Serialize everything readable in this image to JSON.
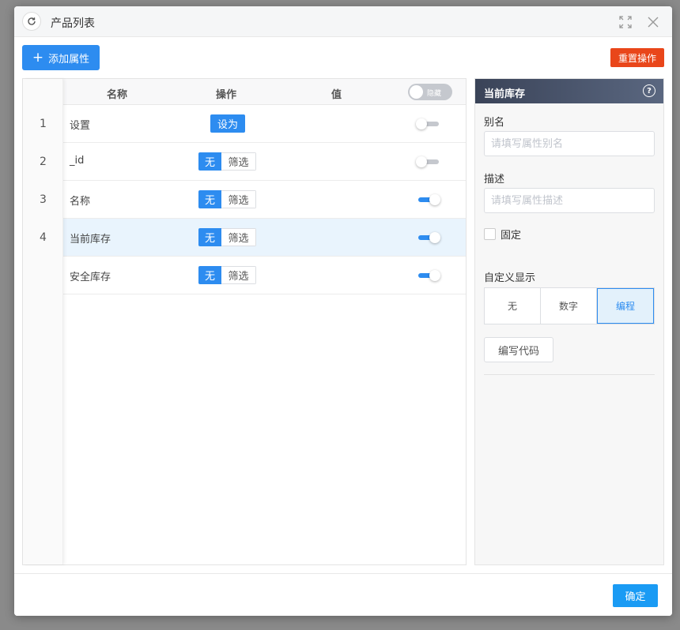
{
  "dialog": {
    "title": "产品列表"
  },
  "toolbar": {
    "add_label": "添加属性",
    "reset_label": "重置操作"
  },
  "table": {
    "headers": {
      "name": "名称",
      "action": "操作",
      "value": "值",
      "toggle_label": "隐藏"
    },
    "rows": [
      {
        "index": "1",
        "name": "设置",
        "action": "设为",
        "visible": false
      },
      {
        "index": "2",
        "name": "_id",
        "seg_on": "无",
        "seg_off": "筛选",
        "visible": false
      },
      {
        "index": "3",
        "name": "名称",
        "seg_on": "无",
        "seg_off": "筛选",
        "visible": true
      },
      {
        "index": "4",
        "name": "当前库存",
        "seg_on": "无",
        "seg_off": "筛选",
        "visible": true,
        "selected": true
      },
      {
        "index": "",
        "name": "安全库存",
        "seg_on": "无",
        "seg_off": "筛选",
        "visible": true
      }
    ]
  },
  "panel": {
    "title": "当前库存",
    "alias_label": "别名",
    "alias_placeholder": "请填写属性别名",
    "desc_label": "描述",
    "desc_placeholder": "请填写属性描述",
    "fixed_label": "固定",
    "display_label": "自定义显示",
    "display_options": [
      "无",
      "数字",
      "编程"
    ],
    "display_selected": "编程",
    "code_button": "编写代码"
  },
  "footer": {
    "ok_label": "确定"
  },
  "colors": {
    "primary": "#2d8cf0",
    "danger": "#e9461a",
    "panel_head": "#3a4358"
  }
}
